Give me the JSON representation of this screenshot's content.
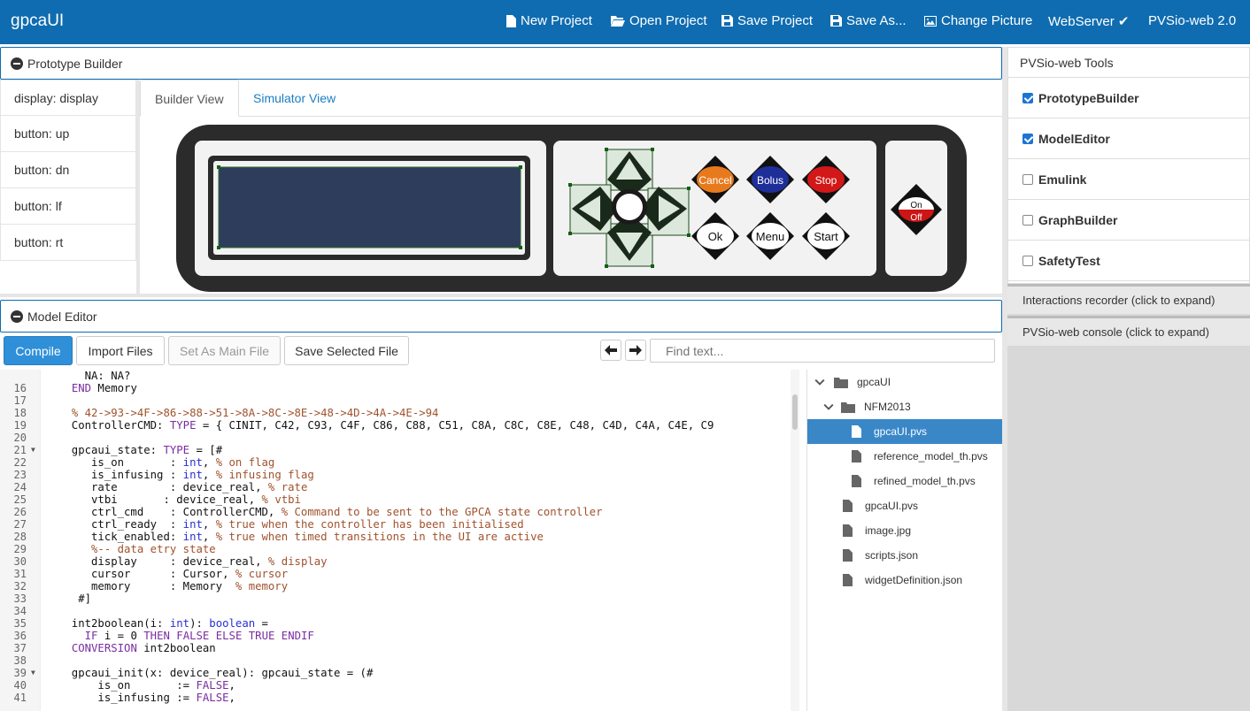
{
  "app": {
    "title": "gpcaUI"
  },
  "nav": {
    "new_project": "New Project",
    "open_project": "Open Project",
    "save_project": "Save Project",
    "save_as": "Save As...",
    "change_picture": "Change Picture",
    "webserver": "WebServer ✔",
    "version": "PVSio-web 2.0"
  },
  "prototype_builder": {
    "title": "Prototype Builder",
    "widgets": [
      "display: display",
      "button: up",
      "button: dn",
      "button: lf",
      "button: rt"
    ],
    "tabs": {
      "builder": "Builder View",
      "simulator": "Simulator View"
    },
    "device_buttons": {
      "cancel": "Cancel",
      "bolus": "Bolus",
      "stop": "Stop",
      "ok": "Ok",
      "menu": "Menu",
      "start": "Start",
      "on": "On",
      "off": "Off"
    }
  },
  "model_editor": {
    "title": "Model Editor",
    "toolbar": {
      "compile": "Compile",
      "import_files": "Import Files",
      "set_main": "Set As Main File",
      "save_selected": "Save Selected File",
      "find_placeholder": "Find text..."
    },
    "code_lines": [
      {
        "n": "",
        "t": "    NA: NA?"
      },
      {
        "n": "16",
        "t": "  END Memory"
      },
      {
        "n": "17",
        "t": ""
      },
      {
        "n": "18",
        "t": "  % 42->93->4F->86->88->51->8A->8C->8E->48->4D->4A->4E->94"
      },
      {
        "n": "19",
        "t": "  ControllerCMD: TYPE = { CINIT, C42, C93, C4F, C86, C88, C51, C8A, C8C, C8E, C48, C4D, C4A, C4E, C9"
      },
      {
        "n": "20",
        "t": ""
      },
      {
        "n": "21",
        "t": "  gpcaui_state: TYPE = [#"
      },
      {
        "n": "22",
        "t": "     is_on       : int, % on flag"
      },
      {
        "n": "23",
        "t": "     is_infusing : int, % infusing flag"
      },
      {
        "n": "24",
        "t": "     rate        : device_real, % rate"
      },
      {
        "n": "25",
        "t": "     vtbi       : device_real, % vtbi"
      },
      {
        "n": "26",
        "t": "     ctrl_cmd    : ControllerCMD, % Command to be sent to the GPCA state controller"
      },
      {
        "n": "27",
        "t": "     ctrl_ready  : int, % true when the controller has been initialised"
      },
      {
        "n": "28",
        "t": "     tick_enabled: int, % true when timed transitions in the UI are active"
      },
      {
        "n": "29",
        "t": "     %-- data etry state"
      },
      {
        "n": "30",
        "t": "     display     : device_real, % display"
      },
      {
        "n": "31",
        "t": "     cursor      : Cursor, % cursor"
      },
      {
        "n": "32",
        "t": "     memory      : Memory  % memory"
      },
      {
        "n": "33",
        "t": "   #]"
      },
      {
        "n": "34",
        "t": ""
      },
      {
        "n": "35",
        "t": "  int2boolean(i: int): boolean ="
      },
      {
        "n": "36",
        "t": "    IF i = 0 THEN FALSE ELSE TRUE ENDIF"
      },
      {
        "n": "37",
        "t": "  CONVERSION int2boolean"
      },
      {
        "n": "38",
        "t": ""
      },
      {
        "n": "39",
        "t": "  gpcaui_init(x: device_real): gpcaui_state = (#"
      },
      {
        "n": "40",
        "t": "      is_on       := FALSE,"
      },
      {
        "n": "41",
        "t": "      is_infusing := FALSE,"
      }
    ],
    "files": [
      {
        "name": "gpcaUI",
        "type": "folder"
      },
      {
        "name": "NFM2013",
        "type": "folder"
      },
      {
        "name": "gpcaUI.pvs",
        "type": "file",
        "selected": true
      },
      {
        "name": "reference_model_th.pvs",
        "type": "file"
      },
      {
        "name": "refined_model_th.pvs",
        "type": "file"
      },
      {
        "name": "gpcaUI.pvs",
        "type": "file"
      },
      {
        "name": "image.jpg",
        "type": "file"
      },
      {
        "name": "scripts.json",
        "type": "file"
      },
      {
        "name": "widgetDefinition.json",
        "type": "file"
      }
    ]
  },
  "tools": {
    "title": "PVSio-web Tools",
    "items": [
      {
        "label": "PrototypeBuilder",
        "checked": true
      },
      {
        "label": "ModelEditor",
        "checked": true
      },
      {
        "label": "Emulink",
        "checked": false
      },
      {
        "label": "GraphBuilder",
        "checked": false
      },
      {
        "label": "SafetyTest",
        "checked": false
      }
    ],
    "recorder": "Interactions recorder (click to expand)",
    "console": "PVSio-web console (click to expand)"
  },
  "colors": {
    "brand": "#0f6cb0",
    "selected": "#3a87c8",
    "display": "#2e3d5c"
  }
}
